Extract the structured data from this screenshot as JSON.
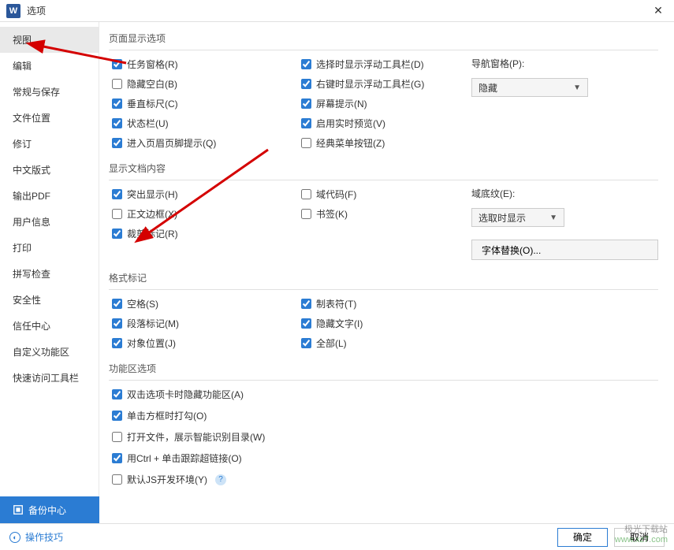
{
  "titlebar": {
    "title": "选项"
  },
  "sidebar": {
    "items": [
      "视图",
      "编辑",
      "常规与保存",
      "文件位置",
      "修订",
      "中文版式",
      "输出PDF",
      "用户信息",
      "打印",
      "拼写检查",
      "安全性",
      "信任中心",
      "自定义功能区",
      "快速访问工具栏"
    ],
    "backup": "备份中心"
  },
  "sections": {
    "page_display": {
      "title": "页面显示选项",
      "col1": [
        "任务窗格(R)",
        "隐藏空白(B)",
        "垂直标尺(C)",
        "状态栏(U)",
        "进入页眉页脚提示(Q)"
      ],
      "col1_checked": [
        true,
        false,
        true,
        true,
        true
      ],
      "col2": [
        "选择时显示浮动工具栏(D)",
        "右键时显示浮动工具栏(G)",
        "屏幕提示(N)",
        "启用实时预览(V)",
        "经典菜单按钮(Z)"
      ],
      "col2_checked": [
        true,
        true,
        true,
        true,
        false
      ],
      "nav_label": "导航窗格(P):",
      "nav_value": "隐藏"
    },
    "doc_content": {
      "title": "显示文档内容",
      "col1": [
        "突出显示(H)",
        "正文边框(X)",
        "裁剪标记(R)"
      ],
      "col1_checked": [
        true,
        false,
        true
      ],
      "col2": [
        "域代码(F)",
        "书签(K)"
      ],
      "col2_checked": [
        false,
        false
      ],
      "shade_label": "域底纹(E):",
      "shade_value": "选取时显示",
      "font_replace": "字体替换(O)..."
    },
    "format_marks": {
      "title": "格式标记",
      "col1": [
        "空格(S)",
        "段落标记(M)",
        "对象位置(J)"
      ],
      "col1_checked": [
        true,
        true,
        true
      ],
      "col2": [
        "制表符(T)",
        "隐藏文字(I)",
        "全部(L)"
      ],
      "col2_checked": [
        true,
        true,
        true
      ]
    },
    "ribbon": {
      "title": "功能区选项",
      "items": [
        "双击选项卡时隐藏功能区(A)",
        "单击方框时打勾(O)",
        "打开文件，展示智能识别目录(W)",
        "用Ctrl + 单击跟踪超链接(O)",
        "默认JS开发环境(Y)"
      ],
      "checked": [
        true,
        true,
        false,
        true,
        false
      ]
    }
  },
  "footer": {
    "tips": "操作技巧",
    "ok": "确定",
    "cancel": "取消"
  },
  "watermark": {
    "line1": "极光下载站",
    "line2": "www.xz7.com"
  }
}
